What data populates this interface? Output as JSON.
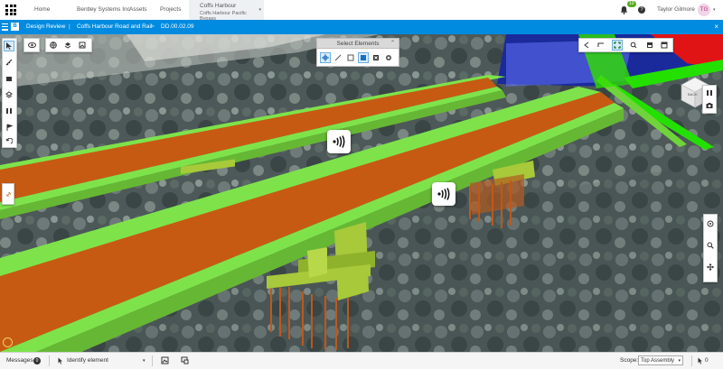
{
  "topbar": {
    "nav": [
      "Home",
      "Bentley Systems Inc",
      "Assets",
      "Projects"
    ],
    "active_tab": {
      "title": "Coffs Harbour",
      "subtitle": "Coffs Harbour Pacific Bypass"
    },
    "notification_count": "10",
    "help_glyph": "?",
    "user_name": "Taylor Gilmore",
    "user_initials": "TG"
  },
  "breadcrumb": {
    "items": [
      "Design Review",
      "Coffs Harbour Road and Rail",
      "DD.00.02.09"
    ],
    "separator": "|",
    "arrow": ">",
    "logo_glyph": "B"
  },
  "select_window": {
    "title": "Select Elements"
  },
  "view_cube": {
    "face_label": "BACK"
  },
  "bottombar": {
    "messages_label": "Messages",
    "messages_count": "0",
    "identify_label": "Identify element",
    "scope_label": "Scope:",
    "scope_value": "Top Assembly",
    "selection_count": "0"
  },
  "colors": {
    "accent": "#008be1",
    "deck": "#c75a12",
    "girder_green": "#7ee34a",
    "highlight_green": "#23e000",
    "pier": "#a8c93a",
    "road_blue": "#1020c0",
    "alert_red": "#e01010"
  },
  "icons": {
    "app_launcher": "grid-icon",
    "notifications": "bell-icon",
    "sensor": "sensor-wave-icon"
  }
}
